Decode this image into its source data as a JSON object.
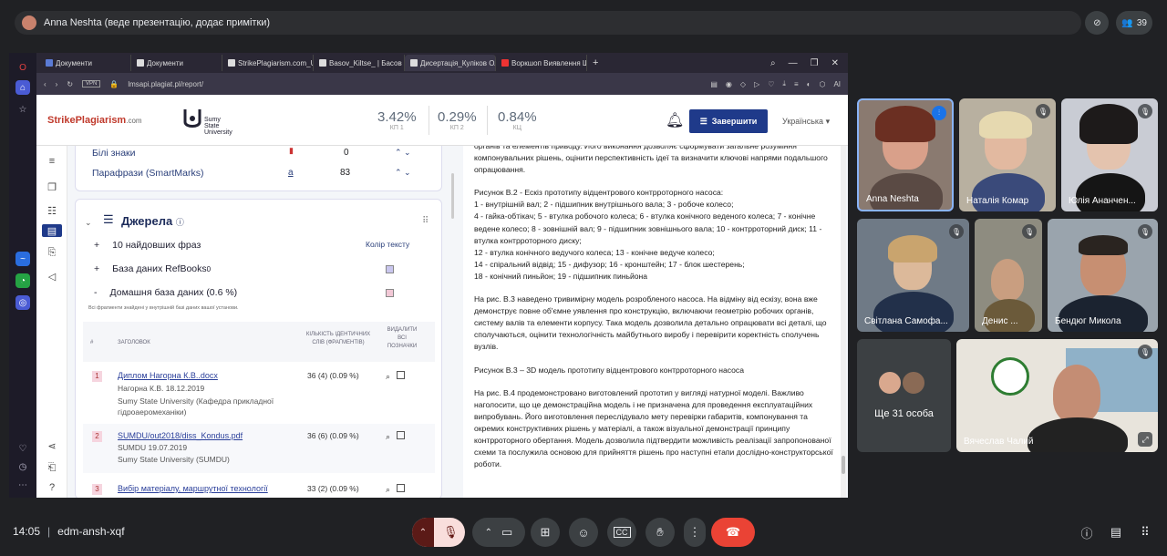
{
  "presenter": {
    "label": "Anna Neshta (веде презентацію, додає примітки)"
  },
  "top_right": {
    "participants_count": "39"
  },
  "browser": {
    "tabs": [
      {
        "label": "Документи"
      },
      {
        "label": "Документи"
      },
      {
        "label": "StrikePlagiarism.com_UA"
      },
      {
        "label": "Basov_Kiltse_ | Басов Анд"
      },
      {
        "label": "Дисертація_Куліков Оле"
      },
      {
        "label": "Воркшоп Виявлення ШІ"
      }
    ],
    "active_tab": 4,
    "address": "lmsapi.plagiat.pl/report/",
    "vpn": "VPN",
    "ai_label": "AI"
  },
  "report": {
    "logo": {
      "brand": "StrikePlagiarism",
      "suffix": ".com",
      "university": "Sumy State University"
    },
    "metrics": [
      {
        "value": "3.42%",
        "label": "КП 1"
      },
      {
        "value": "0.29%",
        "label": "КП 2"
      },
      {
        "value": "0.84%",
        "label": "КЦ"
      }
    ],
    "finish_button": "Завершити",
    "language": "Українська",
    "top_panel": [
      {
        "label": "Білі знаки",
        "marker": "",
        "value": "0"
      },
      {
        "label": "Парафрази (SmartMarks)",
        "marker": "а",
        "value": "83"
      }
    ],
    "sources": {
      "title": "Джерела",
      "color_text": "Колір тексту",
      "rows": [
        {
          "sign": "+",
          "label": "10 найдовших фраз"
        },
        {
          "sign": "+",
          "label": "База даних RefBooks",
          "suffix": "0"
        },
        {
          "sign": "-",
          "label": "Домашня база даних (0.6 %)"
        }
      ],
      "home_note": "Всі фрагменти знайдені у внутрішній базі даних вашої установи.",
      "table_headers": {
        "num": "#",
        "title": "ЗАГОЛОВОК",
        "count": "КІЛЬКІСТЬ ІДЕНТИЧНИХ СЛІВ (ФРАГМЕНТІВ)",
        "remove": "ВИДАЛИТИ ВСІ ПОЗНАЧКИ"
      },
      "items": [
        {
          "num": "1",
          "link": "Диплом Нагорна К.В..docx",
          "author": "Нагорна К.В. 18.12.2019",
          "org": "Sumy State University (Кафедра прикладної гідроаеромеханіки)",
          "count": "36 (4)  (0.09 %)"
        },
        {
          "num": "2",
          "link": "SUMDU/out2018/diss_Kondus.pdf",
          "author": "SUMDU 19.07.2019",
          "org": "Sumy State University (SUMDU)",
          "count": "36 (6)  (0.09 %)"
        },
        {
          "num": "3",
          "link": "Вибір матеріалу, маршрутної технології",
          "author": "",
          "org": "",
          "count": "33 (2)  (0.09 %)"
        }
      ]
    },
    "document": {
      "paragraphs": [
        "органів та елементів приводу. Його виконання дозволяє сформувати загальне розуміння компонувальних рішень, оцінити перспективність ідеї та визначити ключові напрями подальшого опрацювання.",
        "Рисунок В.2 - Ескіз прототипу відцентрового контрроторного насоса:",
        "1 - внутрішній вал; 2 - підшипник внутрішнього вала; 3 - робоче колесо;",
        "4 - гайка-обтікач; 5 - втулка робочого колеса; 6 - втулка конічного веденого колеса; 7 - конічне ведене колесо; 8 - зовнішній вал; 9 - підшипник зовнішнього вала; 10 - контрроторний диск; 11 - втулка контрроторного диску;",
        "12 - втулка конічного ведучого колеса; 13 - конічне ведуче колесо;",
        "14 - спіральний відвід; 15 - дифузор; 16 - кронштейн; 17 - блок шестерень;",
        "18 - конічний пиньйон; 19 - підшипник пиньйона",
        "На рис. В.3 наведено тривимірну модель розробленого насоса. На відміну від ескізу, вона вже демонструє повне об'ємне уявлення про конструкцію, включаючи геометрію робочих органів, систему валів та елементи корпусу. Така модель дозволила детально опрацювати всі деталі, що сполучаються, оцінити технологічність майбутнього виробу і перевірити коректність сполучень вузлів.",
        "Рисунок В.3 – 3D модель прототипу відцентрового контрроторного насоса",
        "На рис. В.4 продемонстровано виготовлений прототип у вигляді натурної моделі. Важливо наголосити, що це демонстраційна модель і не призначена для проведення експлуатаційних випробувань. Його виготовлення переслідувало мету перевірки габаритів, компонування та окремих конструктивних рішень у матеріалі, а також візуальної демонстрації принципу контрроторного обертання. Модель дозволила підтвердити можливість реалізації запропонованої схеми та послужила основою для прийняття рішень про наступні етапи дослідно-конструкторської роботи."
      ]
    }
  },
  "participants": [
    {
      "name": "Anna Neshta"
    },
    {
      "name": "Наталія Комар"
    },
    {
      "name": "Юлія Ананчен..."
    },
    {
      "name": "Світлана Самофа..."
    },
    {
      "name": "Денис ..."
    },
    {
      "name": "Бендюг Микола"
    },
    {
      "name": "Ще 31 особа"
    },
    {
      "name": "Вячеслав Чалий"
    }
  ],
  "bottom": {
    "time": "14:05",
    "meeting_code": "edm-ansh-xqf"
  }
}
